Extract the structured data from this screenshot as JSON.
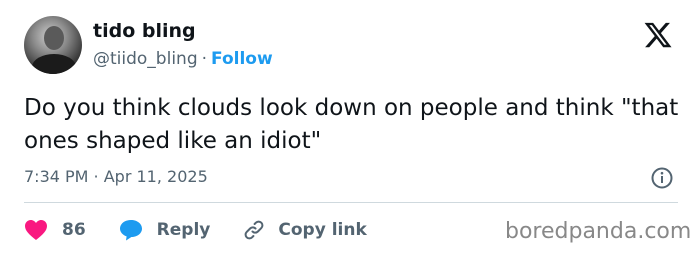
{
  "author": {
    "display_name": "tido bling",
    "handle": "@tiido_bling",
    "separator": "·",
    "follow_label": "Follow"
  },
  "tweet": {
    "text": "Do you think clouds look down on people and think \"that ones shaped like an idiot\"",
    "timestamp": "7:34 PM · Apr 11, 2025"
  },
  "actions": {
    "likes_count": "86",
    "reply_label": "Reply",
    "copy_link_label": "Copy link"
  },
  "icons": {
    "platform": "x-logo-icon",
    "info": "info-icon",
    "like": "heart-icon",
    "reply": "speech-bubble-icon",
    "copy_link": "link-icon"
  },
  "watermark": "boredpanda.com",
  "colors": {
    "accent": "#1d9bf0",
    "like": "#f91880",
    "text": "#0f1419",
    "muted": "#536471"
  }
}
